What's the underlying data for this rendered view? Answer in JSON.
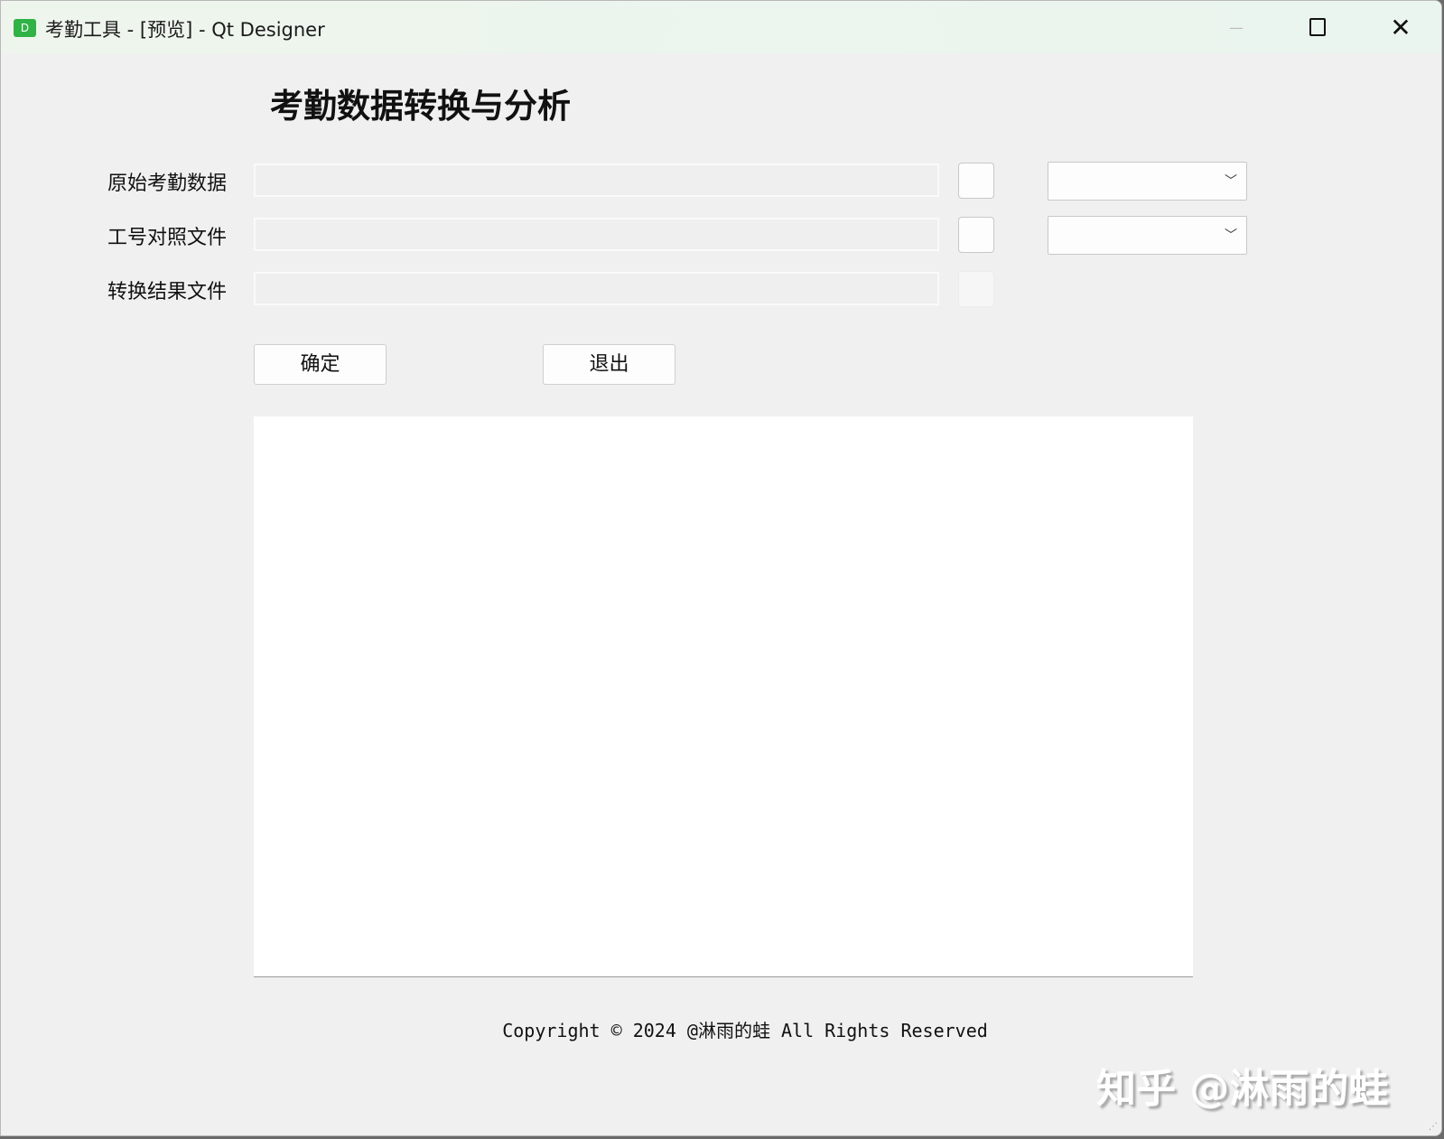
{
  "window": {
    "title": "考勤工具 - [预览] - Qt Designer",
    "app_icon": "D"
  },
  "heading": "考勤数据转换与分析",
  "rows": [
    {
      "label": "原始考勤数据",
      "value": "",
      "has_combo": true
    },
    {
      "label": "工号对照文件",
      "value": "",
      "has_combo": true
    },
    {
      "label": "转换结果文件",
      "value": "",
      "has_combo": false
    }
  ],
  "buttons": {
    "confirm": "确定",
    "exit": "退出"
  },
  "output_text": "",
  "footer": {
    "copyright": "Copyright © 2024 @淋雨的蛙 All Rights Reserved"
  },
  "watermark": "知乎 @淋雨的蛙"
}
